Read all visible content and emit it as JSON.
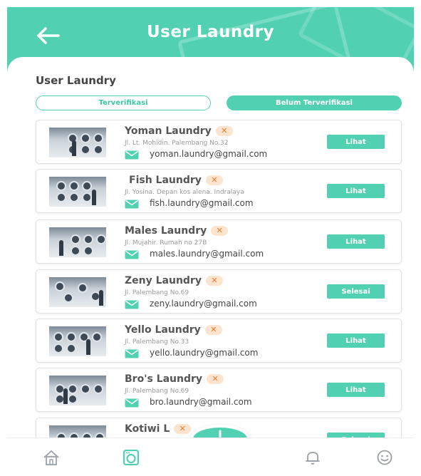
{
  "header": {
    "title": "User Laundry",
    "back_icon": "arrow-left-icon"
  },
  "section_title": "User Laundry",
  "tabs": [
    {
      "label": "Terverifikasi",
      "active": false
    },
    {
      "label": "Belum Terverifikasi",
      "active": true
    }
  ],
  "laundries": [
    {
      "name": "Yoman Laundry",
      "address": "Jl. Lt. Mohidin. Palembang No.32",
      "email": "yoman.laundry@gmail.com",
      "action": "Lihat"
    },
    {
      "name": "Fish Laundry",
      "address": "Jl. Yosina. Depan kos alena. Indralaya",
      "email": "fish.laundry@gmail.com",
      "action": "Lihat"
    },
    {
      "name": "Males Laundry",
      "address": "Jl. Mujahir. Rumah no 27B",
      "email": "males.laundry@gmail.com",
      "action": "Lihat"
    },
    {
      "name": "Zeny Laundry",
      "address": "Jl. Palembang No.69",
      "email": "zeny.laundry@gmail.com",
      "action": "Selesai"
    },
    {
      "name": "Yello Laundry",
      "address": "Jl. Palembang No.33",
      "email": "yello.laundry@gmail.com",
      "action": "Lihat"
    },
    {
      "name": "Bro's Laundry",
      "address": "Jl. Palembang No.69",
      "email": "bro.laundry@gmail.com",
      "action": "Lihat"
    },
    {
      "name": "Kotiwi L",
      "address": "",
      "email": "",
      "action": "Selesai"
    }
  ],
  "status_icon": "x-icon",
  "mail_icon": "mail-icon",
  "bottom_nav": {
    "items": [
      {
        "icon": "home-icon"
      },
      {
        "icon": "laundry-machine-icon",
        "active": true
      },
      {
        "icon": "bell-icon"
      },
      {
        "icon": "smile-icon"
      }
    ],
    "fab_icon": "plus-icon"
  },
  "colors": {
    "primary": "#52d1b2",
    "badge_bg": "#fde4cf",
    "badge_fg": "#f07a2e"
  }
}
